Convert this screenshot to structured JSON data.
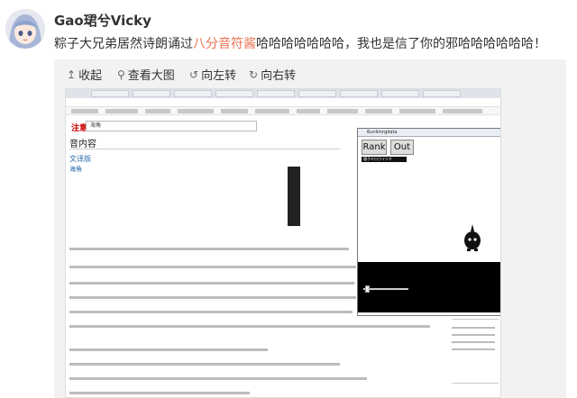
{
  "post": {
    "username": "Gao珺兮Vicky",
    "text_before": "粽子大兄弟居然诗朗诵过",
    "text_link": "八分音符酱",
    "text_after": "哈哈哈哈哈哈哈，我也是信了你的邪哈哈哈哈哈哈！"
  },
  "toolbar": {
    "collapse": "收起",
    "view_large": "查看大图",
    "rotate_left": "向左转",
    "rotate_right": "向右转"
  },
  "screenshot": {
    "site_logo": "注意",
    "search_value": "海角",
    "section_title": "音内容",
    "sub1": "文译版",
    "sub2": "海角",
    "game_window_title": "6unlimrgdata",
    "game_buttons": {
      "rank": "Rank",
      "out": "Out"
    },
    "game_badge": "寝子ヤロウイツチ"
  },
  "colors": {
    "link": "#eb7350",
    "text": "#333333",
    "viewer_bg": "#f2f2f2"
  }
}
